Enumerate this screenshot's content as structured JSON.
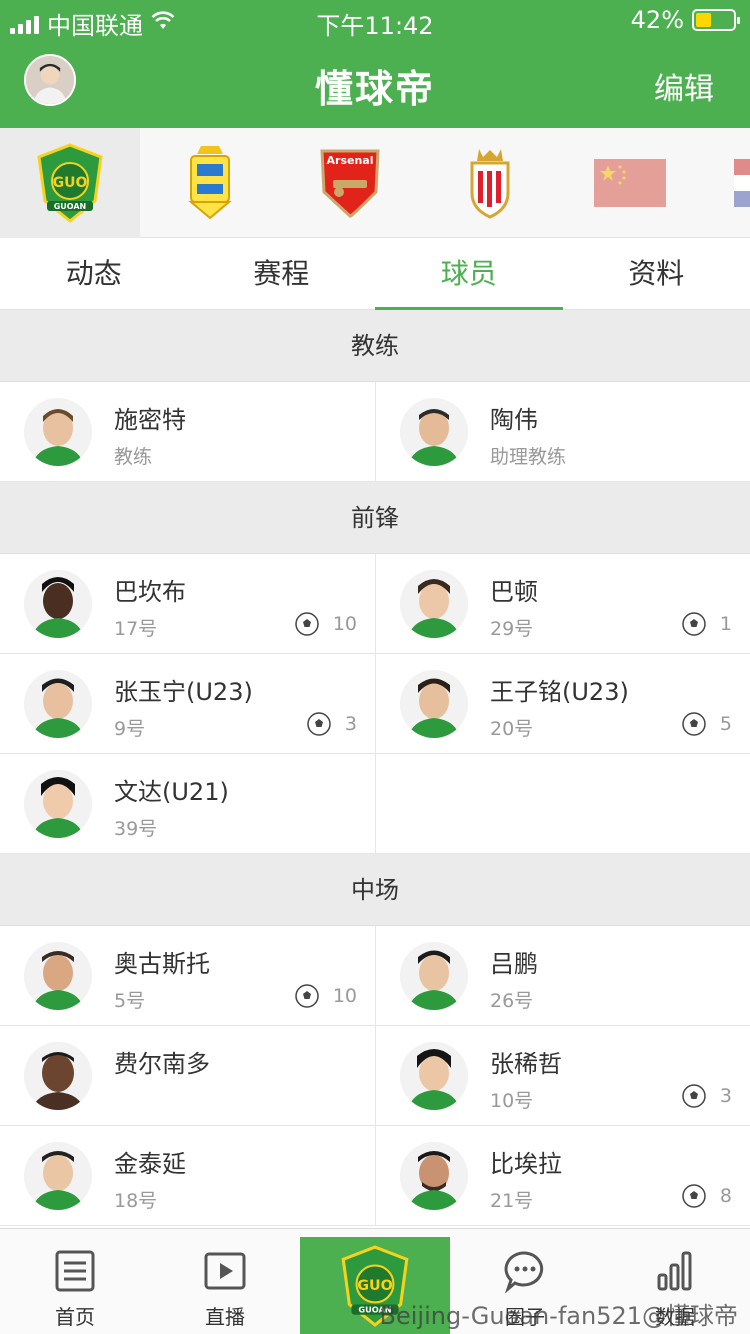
{
  "status_bar": {
    "carrier": "中国联通",
    "time": "下午11:42",
    "battery": "42%",
    "battery_level": 0.42
  },
  "header": {
    "title": "懂球帝",
    "edit_label": "编辑"
  },
  "teams": [
    {
      "name": "guoan-logo",
      "active": true
    },
    {
      "name": "las-palmas-logo"
    },
    {
      "name": "arsenal-logo",
      "text": "Arsenal"
    },
    {
      "name": "monaco-logo"
    },
    {
      "name": "china-flag"
    },
    {
      "name": "netherlands-flag"
    }
  ],
  "tabs": [
    {
      "label": "动态"
    },
    {
      "label": "赛程"
    },
    {
      "label": "球员",
      "active": true
    },
    {
      "label": "资料"
    }
  ],
  "sections": {
    "coach": "教练",
    "forward": "前锋",
    "midfield": "中场"
  },
  "coaches": [
    {
      "name": "施密特",
      "role": "教练"
    },
    {
      "name": "陶伟",
      "role": "助理教练"
    }
  ],
  "forwards": [
    {
      "name": "巴坎布",
      "number": "17号",
      "goals": "10"
    },
    {
      "name": "巴顿",
      "number": "29号",
      "goals": "1"
    },
    {
      "name": "张玉宁(U23)",
      "number": "9号",
      "goals": "3"
    },
    {
      "name": "王子铭(U23)",
      "number": "20号",
      "goals": "5"
    },
    {
      "name": "文达(U21)",
      "number": "39号"
    }
  ],
  "midfielders": [
    {
      "name": "奥古斯托",
      "number": "5号",
      "goals": "10"
    },
    {
      "name": "吕鹏",
      "number": "26号"
    },
    {
      "name": "费尔南多",
      "number": ""
    },
    {
      "name": "张稀哲",
      "number": "10号",
      "goals": "3"
    },
    {
      "name": "金泰延",
      "number": "18号"
    },
    {
      "name": "比埃拉",
      "number": "21号",
      "goals": "8"
    }
  ],
  "bottom_nav": [
    {
      "label": "首页",
      "icon": "news-icon"
    },
    {
      "label": "直播",
      "icon": "play-icon"
    },
    {
      "label": "",
      "icon": "guoan-logo"
    },
    {
      "label": "圈子",
      "icon": "chat-icon"
    },
    {
      "label": "数据",
      "icon": "chart-icon"
    }
  ],
  "watermark": "Beijing-Guoan-fan521@懂球帝",
  "colors": {
    "brand": "#4caf50",
    "section_bg": "#ebebeb"
  }
}
